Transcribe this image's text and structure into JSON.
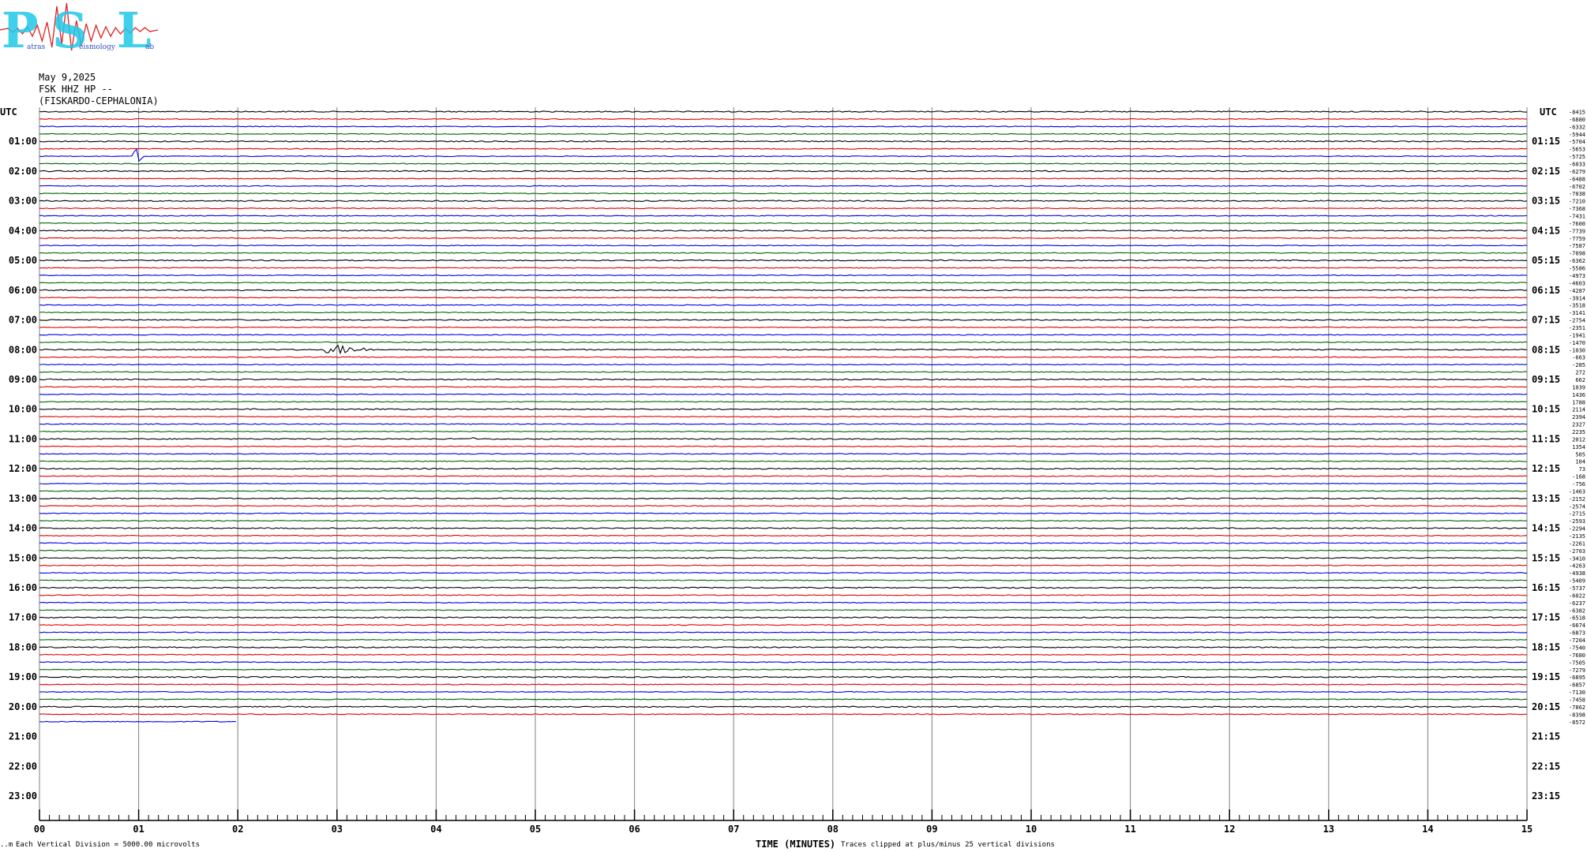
{
  "logo": {
    "letters": [
      "P",
      "S",
      "L"
    ],
    "subwords": [
      "atras",
      "eismology",
      "ab"
    ],
    "colors": {
      "letters": "#20c8e8",
      "wave": "#e02020"
    }
  },
  "header": {
    "date": "May 9,2025",
    "channel": "FSK HHZ HP --",
    "station": "(FISKARDO-CEPHALONIA)"
  },
  "axes": {
    "left_label": "UTC",
    "right_label": "UTC",
    "x_label": "TIME (MINUTES)"
  },
  "footer": {
    "scale_note": "Each Vertical Division = 5000.00 microvolts",
    "clip_note": "Traces clipped at plus/minus 25 vertical divisions",
    "corner_mark": "..m"
  },
  "chart_data": {
    "type": "line",
    "title": "FSK HHZ HP --",
    "x_axis": {
      "label": "TIME (MINUTES)",
      "range": [
        0,
        15
      ],
      "ticks": [
        "00",
        "01",
        "02",
        "03",
        "04",
        "05",
        "06",
        "07",
        "08",
        "09",
        "10",
        "11",
        "12",
        "13",
        "14",
        "15"
      ]
    },
    "left_hour_labels": [
      "01:00",
      "02:00",
      "03:00",
      "04:00",
      "05:00",
      "06:00",
      "07:00",
      "08:00",
      "09:00",
      "10:00",
      "11:00",
      "12:00",
      "13:00",
      "14:00",
      "15:00",
      "16:00",
      "17:00",
      "18:00",
      "19:00",
      "20:00",
      "21:00",
      "22:00",
      "23:00"
    ],
    "right_hour_labels": [
      "01:15",
      "02:15",
      "03:15",
      "04:15",
      "05:15",
      "06:15",
      "07:15",
      "08:15",
      "09:15",
      "10:15",
      "11:15",
      "12:15",
      "13:15",
      "14:15",
      "15:15",
      "16:15",
      "17:15",
      "18:15",
      "19:15",
      "20:15",
      "21:15",
      "22:15",
      "23:15"
    ],
    "trace_colors": [
      "#000000",
      "#e00000",
      "#0000e0",
      "#006400"
    ],
    "trace_count_full": 83,
    "last_trace_minutes": 2.0,
    "trace_offsets": [
      -8415,
      -6880,
      -6332,
      -5944,
      -5704,
      -5653,
      -5725,
      -6033,
      -6279,
      -6488,
      -6702,
      -7038,
      -7210,
      -7368,
      -7431,
      -7600,
      -7739,
      -7759,
      -7587,
      -7098,
      -6362,
      -5586,
      -4973,
      -4603,
      -4287,
      -3914,
      -3518,
      -3141,
      -2754,
      -2351,
      -1941,
      -1470,
      -1030,
      -663,
      -285,
      272,
      662,
      1039,
      1436,
      1788,
      2114,
      2394,
      2327,
      2235,
      2012,
      1354,
      505,
      104,
      73,
      -168,
      -756,
      -1463,
      -2152,
      -2574,
      -2715,
      -2593,
      -2294,
      -2135,
      -2261,
      -2703,
      -3410,
      -4263,
      -4938,
      -5409,
      -5737,
      -6022,
      -6237,
      -6382,
      -6518,
      -6674,
      -6873,
      -7204,
      -7540,
      -7680,
      -7505,
      -7279,
      -6895,
      -6857,
      -7130,
      -7458,
      -7862,
      -8398,
      -8572
    ],
    "events": [
      {
        "trace": 6,
        "minute": 0.98,
        "amplitude": "spike"
      },
      {
        "trace": 32,
        "minute": 3.0,
        "amplitude": "burst"
      },
      {
        "trace": 44,
        "minute": 4.4,
        "amplitude": "small"
      }
    ],
    "grid": true
  }
}
